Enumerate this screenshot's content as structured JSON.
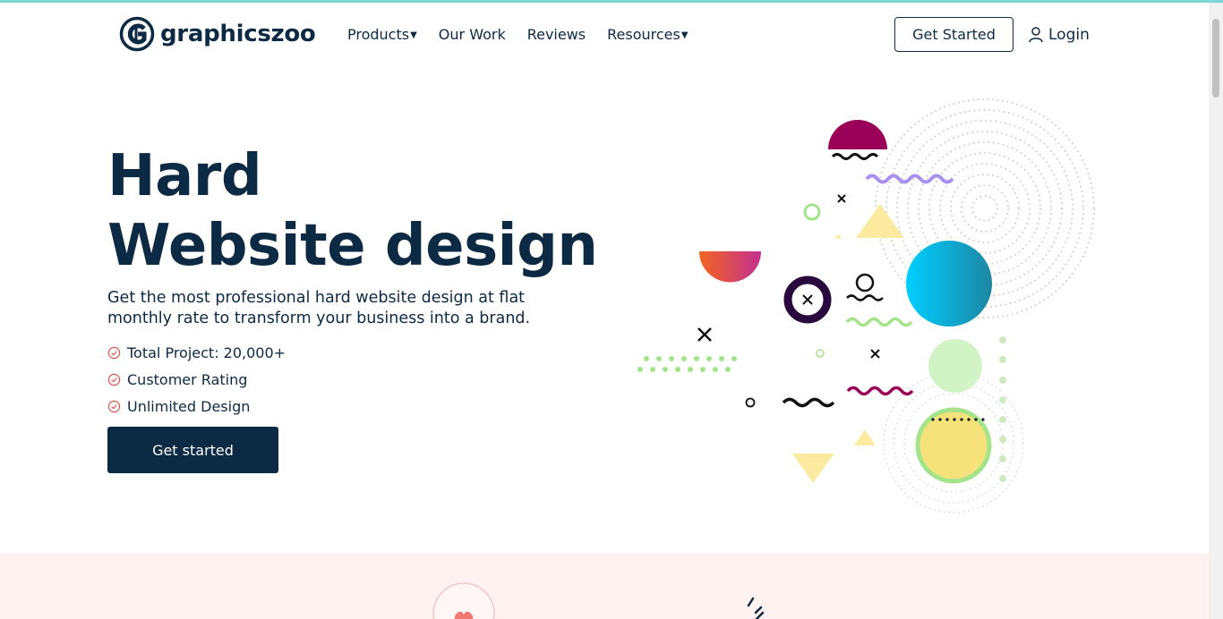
{
  "brand": {
    "name": "graphicszoo",
    "logo_icon": "g-circle-logo"
  },
  "nav": {
    "items": [
      {
        "label": "Products",
        "dropdown": true
      },
      {
        "label": "Our Work",
        "dropdown": false
      },
      {
        "label": "Reviews",
        "dropdown": false
      },
      {
        "label": "Resources",
        "dropdown": true
      }
    ],
    "cta_label": "Get Started",
    "login_label": "Login",
    "login_icon": "user-icon"
  },
  "hero": {
    "title_line1": "Hard",
    "title_line2": "Website design",
    "subtitle": "Get the most professional hard website design at flat monthly rate to transform your business into a brand.",
    "bullets": [
      "Total Project: 20,000+",
      "Customer Rating",
      "Unlimited Design"
    ],
    "bullet_icon": "check-circle-icon",
    "cta_label": "Get started"
  },
  "colors": {
    "navy": "#0d2a44",
    "accent_red": "#e0574f",
    "topline": "#7fd3d3",
    "band": "#fff2f0"
  }
}
